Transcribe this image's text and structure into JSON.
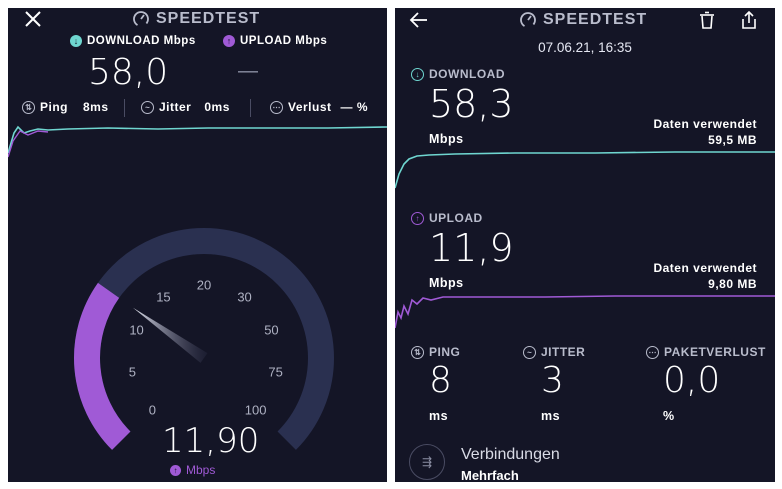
{
  "colors": {
    "background": "#141526",
    "download_cyan": "#6fd6d0",
    "upload_purple": "#a05ad6",
    "gauge_track": "#2a3050",
    "text_muted": "#b9bccc"
  },
  "left": {
    "brand": "SPEEDTEST",
    "download_label": "DOWNLOAD Mbps",
    "download_value": "58,0",
    "upload_label": "UPLOAD Mbps",
    "upload_value": "—",
    "ping_label": "Ping",
    "ping_value": "8ms",
    "jitter_label": "Jitter",
    "jitter_value": "0ms",
    "loss_label": "Verlust",
    "loss_value": "— %",
    "gauge": {
      "ticks": [
        "0",
        "5",
        "10",
        "15",
        "20",
        "30",
        "50",
        "75",
        "100"
      ],
      "value": "11,90",
      "unit": "Mbps",
      "needle_value": 11.9
    }
  },
  "right": {
    "brand": "SPEEDTEST",
    "datetime": "07.06.21, 16:35",
    "download": {
      "label": "DOWNLOAD",
      "value": "58,3",
      "unit": "Mbps",
      "data_label": "Daten verwendet",
      "data_value": "59,5 MB"
    },
    "upload": {
      "label": "UPLOAD",
      "value": "11,9",
      "unit": "Mbps",
      "data_label": "Daten verwendet",
      "data_value": "9,80 MB"
    },
    "ping": {
      "label": "PING",
      "value": "8",
      "unit": "ms"
    },
    "jitter": {
      "label": "JITTER",
      "value": "3",
      "unit": "ms"
    },
    "loss": {
      "label": "PAKETVERLUST",
      "value": "0,0",
      "unit": "%"
    },
    "connections": {
      "label": "Verbindungen",
      "value": "Mehrfach"
    }
  }
}
